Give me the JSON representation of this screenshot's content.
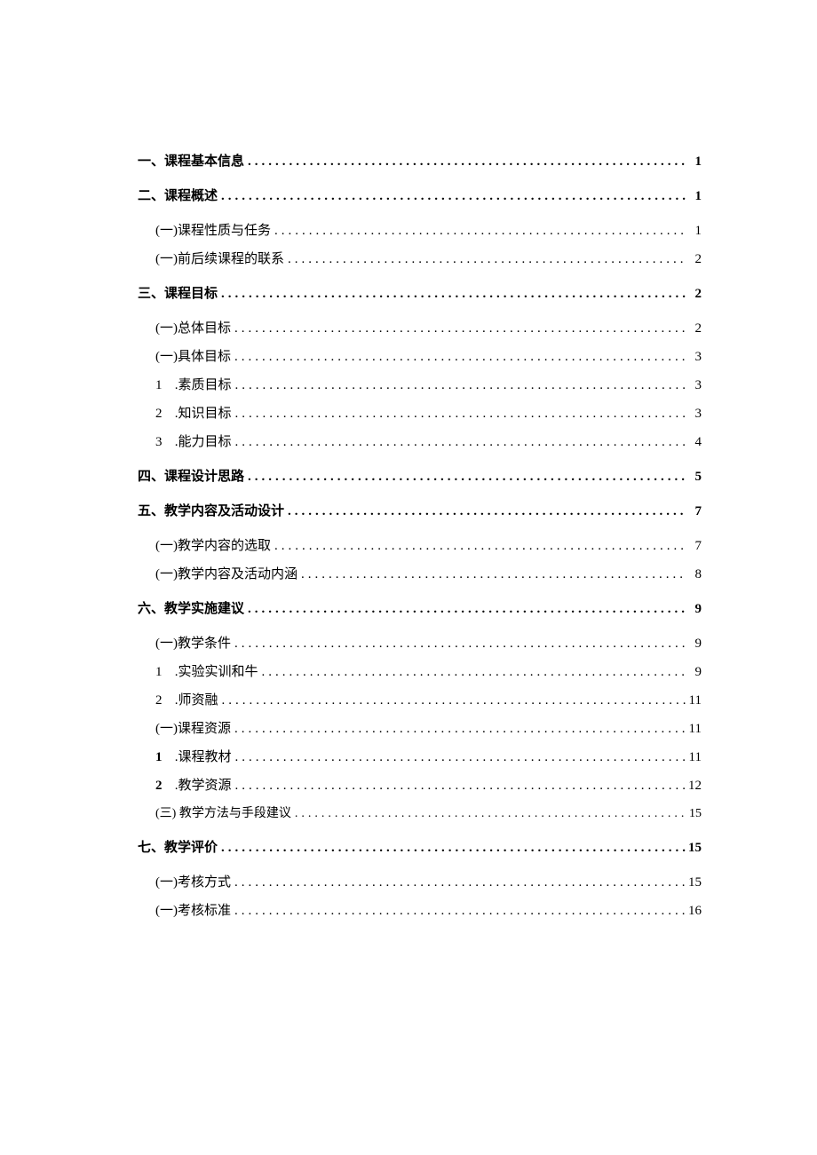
{
  "toc": [
    {
      "level": 1,
      "label": "一、课程基本信息",
      "page": "1"
    },
    {
      "level": 1,
      "label": "二、课程概述",
      "page": "1"
    },
    {
      "level": 2,
      "label": "(一)课程性质与任务",
      "page": "1"
    },
    {
      "level": 2,
      "label": "(一)前后续课程的联系",
      "page": "2"
    },
    {
      "level": 1,
      "label": "三、课程目标",
      "page": "2"
    },
    {
      "level": 2,
      "label": "(一)总体目标",
      "page": "2"
    },
    {
      "level": 2,
      "label": "(一)具体目标",
      "page": "3"
    },
    {
      "level": 3,
      "num": "1",
      "label": ".素质目标",
      "page": "3"
    },
    {
      "level": 3,
      "num": "2",
      "label": ".知识目标",
      "page": "3"
    },
    {
      "level": 3,
      "num": "3",
      "label": ".能力目标",
      "page": "4"
    },
    {
      "level": 1,
      "label": "四、课程设计思路",
      "page": "5"
    },
    {
      "level": 1,
      "label": "五、教学内容及活动设计",
      "page": "7"
    },
    {
      "level": 2,
      "label": "(一)教学内容的选取",
      "page": "7"
    },
    {
      "level": 2,
      "label": "(一)教学内容及活动内涵",
      "page": "8"
    },
    {
      "level": 1,
      "label": "六、教学实施建议",
      "page": "9"
    },
    {
      "level": 2,
      "label": "(一)教学条件",
      "page": "9"
    },
    {
      "level": 3,
      "num": "1",
      "label": ".实验实训和牛",
      "page": "9"
    },
    {
      "level": 3,
      "num": "2",
      "label": ".师资融",
      "page": "11"
    },
    {
      "level": 2,
      "label": "(一)课程资源",
      "page": "11"
    },
    {
      "level": "3bold",
      "num": "1",
      "label": ".课程教材",
      "page": "11"
    },
    {
      "level": "3bold",
      "num": "2",
      "label": ".教学资源",
      "page": "12"
    },
    {
      "level": "3small",
      "label": "(三) 教学方法与手段建议",
      "page": "15"
    },
    {
      "level": 1,
      "label": "七、教学评价",
      "page": "15"
    },
    {
      "level": 2,
      "label": "(一)考核方式",
      "page": "15"
    },
    {
      "level": 2,
      "label": "(一)考核标准",
      "page": "16"
    }
  ]
}
